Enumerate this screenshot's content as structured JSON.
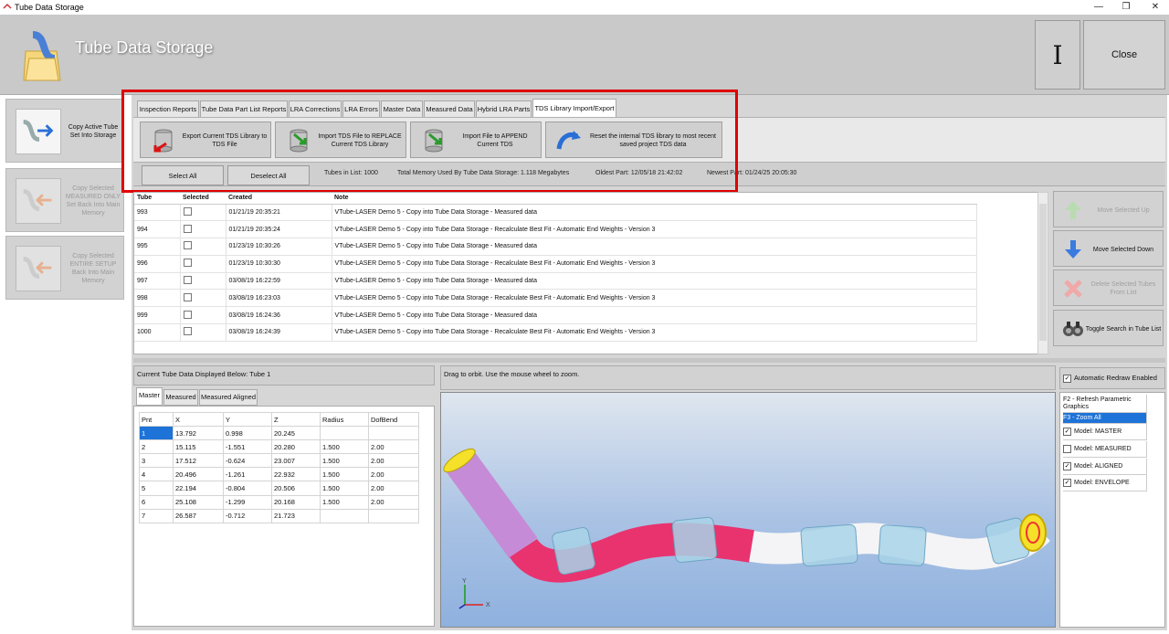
{
  "window": {
    "title": "Tube Data Storage"
  },
  "header": {
    "title": "Tube Data Storage",
    "cursor_glyph": "I",
    "close_label": "Close"
  },
  "left_buttons": [
    {
      "label": "Copy Active Tube Set Into Storage",
      "enabled": true
    },
    {
      "label": "Copy Selected MEASURED ONLY Set Back Into Main Memory",
      "enabled": false
    },
    {
      "label": "Copy Selected ENTIRE SETUP Back Into Main Memory",
      "enabled": false
    }
  ],
  "tabs": [
    {
      "label": "Inspection Reports"
    },
    {
      "label": "Tube Data Part List Reports"
    },
    {
      "label": "LRA Corrections"
    },
    {
      "label": "LRA Errors"
    },
    {
      "label": "Master Data"
    },
    {
      "label": "Measured Data"
    },
    {
      "label": "Hybrid LRA Parts"
    },
    {
      "label": "TDS Library Import/Export",
      "active": true
    }
  ],
  "actions": [
    {
      "label": "Export Current TDS Library to TDS File"
    },
    {
      "label": "Import TDS File to REPLACE Current TDS Library"
    },
    {
      "label": "Import File to APPEND Current TDS"
    },
    {
      "label": "Reset the internal TDS library to most recent saved project TDS data"
    }
  ],
  "info": {
    "select_all": "Select All",
    "deselect_all": "Deselect All",
    "tubes_in_list": "Tubes in List:  1000",
    "memory": "Total Memory Used By Tube Data Storage:  1.118  Megabytes",
    "oldest": "Oldest Part:  12/05/18 21:42:02",
    "newest": "Newest Part:  01/24/25 20:05:30"
  },
  "tube_table": {
    "columns": [
      "Tube",
      "Selected",
      "Created",
      "Note"
    ],
    "rows": [
      {
        "tube": "993",
        "created": "01/21/19 20:35:21",
        "note": "VTube-LASER Demo 5 - Copy into Tube Data Storage - Measured data"
      },
      {
        "tube": "994",
        "created": "01/21/19 20:35:24",
        "note": "VTube-LASER Demo 5 - Copy into Tube Data Storage - Recalculate Best Fit - Automatic End Weights - Version 3"
      },
      {
        "tube": "995",
        "created": "01/23/19 10:30:26",
        "note": "VTube-LASER Demo 5 - Copy into Tube Data Storage - Measured data"
      },
      {
        "tube": "996",
        "created": "01/23/19 10:30:30",
        "note": "VTube-LASER Demo 5 - Copy into Tube Data Storage - Recalculate Best Fit - Automatic End Weights - Version 3"
      },
      {
        "tube": "997",
        "created": "03/08/19 16:22:59",
        "note": "VTube-LASER Demo 5 - Copy into Tube Data Storage - Measured data"
      },
      {
        "tube": "998",
        "created": "03/08/19 16:23:03",
        "note": "VTube-LASER Demo 5 - Copy into Tube Data Storage - Recalculate Best Fit - Automatic End Weights - Version 3"
      },
      {
        "tube": "999",
        "created": "03/08/19 16:24:36",
        "note": "VTube-LASER Demo 5 - Copy into Tube Data Storage - Measured data"
      },
      {
        "tube": "1000",
        "created": "03/08/19 16:24:39",
        "note": "VTube-LASER Demo 5 - Copy into Tube Data Storage - Recalculate Best Fit - Automatic End Weights - Version 3"
      }
    ]
  },
  "right_buttons": [
    {
      "label": "Move Selected Up",
      "enabled": false
    },
    {
      "label": "Move Selected Down",
      "enabled": true
    },
    {
      "label": "Delete Selected Tubes From List",
      "enabled": false
    },
    {
      "label": "Toggle Search in Tube List",
      "enabled": true
    }
  ],
  "lower": {
    "current_tube": "Current Tube Data Displayed Below:  Tube 1",
    "data_tabs": [
      "Master",
      "Measured",
      "Measured Aligned"
    ],
    "pnt_columns": [
      "Pnt",
      "X",
      "Y",
      "Z",
      "Radius",
      "DofBend"
    ],
    "pnt_rows": [
      [
        "1",
        "13.792",
        "0.998",
        "20.245",
        "",
        ""
      ],
      [
        "2",
        "15.115",
        "-1.551",
        "20.280",
        "1.500",
        "2.00"
      ],
      [
        "3",
        "17.512",
        "-0.624",
        "23.007",
        "1.500",
        "2.00"
      ],
      [
        "4",
        "20.496",
        "-1.261",
        "22.932",
        "1.500",
        "2.00"
      ],
      [
        "5",
        "22.194",
        "-0.804",
        "20.506",
        "1.500",
        "2.00"
      ],
      [
        "6",
        "25.108",
        "-1.299",
        "20.168",
        "1.500",
        "2.00"
      ],
      [
        "7",
        "26.587",
        "-0.712",
        "21.723",
        "",
        ""
      ]
    ],
    "view_hint": "Drag to orbit.  Use the mouse wheel to zoom.",
    "axis_y": "Y",
    "axis_x": "X"
  },
  "options": {
    "auto_redraw": "Automatic Redraw Enabled",
    "items": [
      {
        "label": "F2 - Refresh Parametric Graphics",
        "checkbox": false,
        "highlight": false
      },
      {
        "label": "F3 - Zoom All",
        "checkbox": false,
        "highlight": true
      },
      {
        "label": "Model: MASTER",
        "checkbox": true,
        "checked": true
      },
      {
        "label": "Model: MEASURED",
        "checkbox": true,
        "checked": false
      },
      {
        "label": "Model: ALIGNED",
        "checkbox": true,
        "checked": true
      },
      {
        "label": "Model: ENVELOPE",
        "checkbox": true,
        "checked": true
      }
    ]
  },
  "colors": {
    "accent": "#1e73d8",
    "highlight_box": "#e00000",
    "tube_pink": "#e8336f",
    "tube_blue": "#a8d3e8",
    "tube_violet": "#c68bd6"
  }
}
